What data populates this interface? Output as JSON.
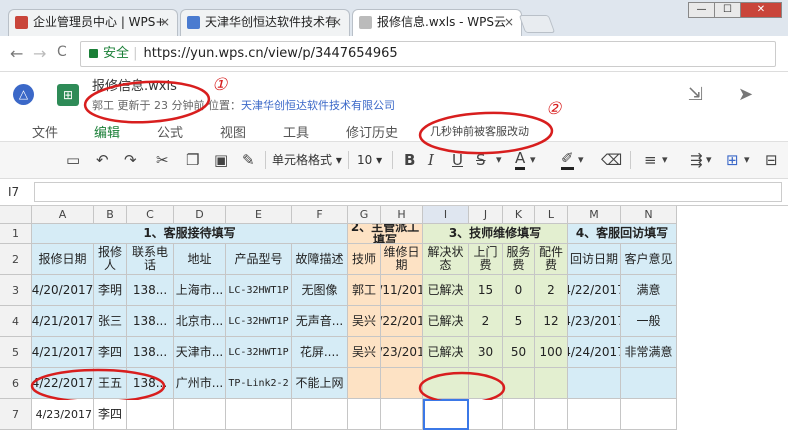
{
  "browser": {
    "tabs": [
      {
        "title": "企业管理员中心 | WPS+",
        "icon_color": "#c9453a",
        "close": "×"
      },
      {
        "title": "天津华创恒达软件技术有",
        "icon_color": "#4a7bd0",
        "close": "×"
      },
      {
        "title": "报修信息.wxls - WPS云",
        "icon_color": "#bbbbbb",
        "close": "×"
      }
    ],
    "window_buttons": [
      "—",
      "☐",
      "✕"
    ],
    "back": "←",
    "forward": "→",
    "reload": "C",
    "secure_label": "安全",
    "url": "https://yun.wps.cn/view/p/3447654965"
  },
  "doc": {
    "logo_icon": "drive-icon",
    "file_icon_label": "⊞",
    "filename": "报修信息.wxls",
    "meta_prefix": "郭工  更新于 23 分钟前  位置：",
    "location": "天津华创恒达软件技术有限公司",
    "pin": "⇲",
    "share": "➤"
  },
  "menu": {
    "items": [
      "文件",
      "编辑",
      "公式",
      "视图",
      "工具",
      "修订历史"
    ],
    "active": 1,
    "notice": "几秒钟前被客服改动"
  },
  "toolbar": {
    "cell_format": "单元格格式 ▾",
    "font_size": "10 ▾"
  },
  "formula": {
    "cell_ref": "I7",
    "value": ""
  },
  "sheet": {
    "columns": [
      "A",
      "B",
      "C",
      "D",
      "E",
      "F",
      "G",
      "H",
      "I",
      "J",
      "K",
      "L",
      "M",
      "N"
    ],
    "selected_column": "I",
    "rows": [
      "1",
      "2",
      "3",
      "4",
      "5",
      "6",
      "7"
    ],
    "sections": [
      {
        "text": "1、客服接待填写",
        "color": "#d6ecf6"
      },
      {
        "text": "2、主管派工填写",
        "color": "#fde2c4"
      },
      {
        "text": "3、技师维修填写",
        "color": "#e3efd0"
      },
      {
        "text": "4、客服回访填写",
        "color": "#d6ecf6"
      }
    ],
    "headers": [
      "报修日期",
      "报修人",
      "联系电话",
      "地址",
      "产品型号",
      "故障描述",
      "技师",
      "维修日期",
      "解决状态",
      "上门费",
      "服务费",
      "配件费",
      "回访日期",
      "客户意见"
    ],
    "data": [
      [
        "4/20/2017",
        "李明",
        "138...",
        "上海市...",
        "LC-32HWT1P",
        "无图像",
        "郭工",
        "4/11/2017",
        "已解决",
        "15",
        "0",
        "2",
        "4/22/2017",
        "满意"
      ],
      [
        "4/21/2017",
        "张三",
        "138...",
        "北京市...",
        "LC-32HWT1P",
        "无声音...",
        "吴兴",
        "4/22/2017",
        "已解决",
        "2",
        "5",
        "12",
        "4/23/2017",
        "一般"
      ],
      [
        "4/21/2017",
        "李四",
        "138...",
        "天津市...",
        "LC-32HWT1P",
        "花屏....",
        "吴兴",
        "4/23/2017",
        "已解决",
        "30",
        "50",
        "100",
        "4/24/2017",
        "非常满意"
      ],
      [
        "4/22/2017",
        "王五",
        "138...",
        "广州市...",
        "TP-Link2-2",
        "不能上网",
        "",
        "",
        "",
        "",
        "",
        "",
        "",
        ""
      ],
      [
        "4/23/2017",
        "李四",
        "",
        "",
        "",
        "",
        "",
        "",
        "",
        "",
        "",
        "",
        "",
        ""
      ]
    ]
  },
  "annotations": {
    "marks": [
      "①",
      "②"
    ],
    "color": "#d81e1e"
  }
}
